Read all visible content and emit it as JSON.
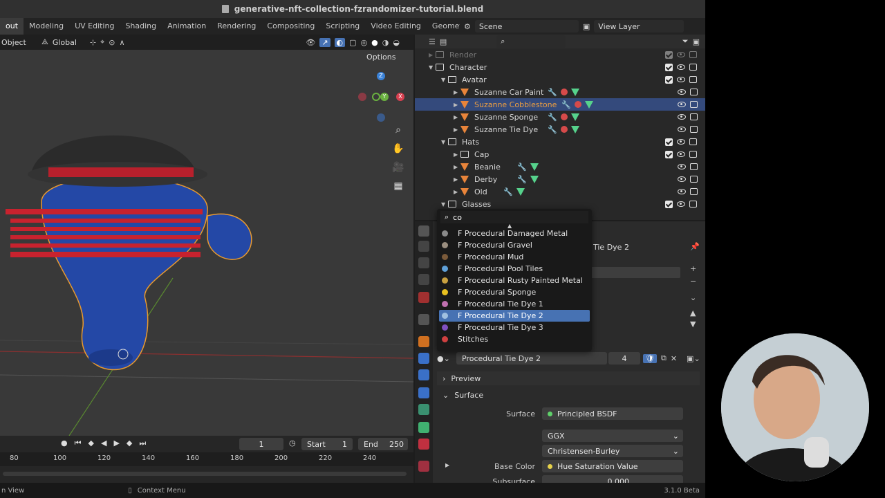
{
  "window": {
    "title": "generative-nft-collection-fzrandomizer-tutorial.blend"
  },
  "workspace_tabs": [
    "out",
    "Modeling",
    "UV Editing",
    "Shading",
    "Animation",
    "Rendering",
    "Compositing",
    "Scripting",
    "Video Editing",
    "Geometry Nodes",
    "+"
  ],
  "scene": {
    "scene_name": "Scene",
    "view_layer": "View Layer"
  },
  "viewport_header": {
    "mode": "Object",
    "transform_orientation": "Global"
  },
  "viewport": {
    "options_label": "Options"
  },
  "outliner": {
    "rows": [
      {
        "label": "Render",
        "dim": true
      },
      {
        "label": "Character"
      },
      {
        "label": "Avatar"
      },
      {
        "label": "Suzanne Car Paint"
      },
      {
        "label": "Suzanne Cobblestone",
        "selected": true
      },
      {
        "label": "Suzanne Sponge"
      },
      {
        "label": "Suzanne Tie Dye"
      },
      {
        "label": "Hats"
      },
      {
        "label": "Cap"
      },
      {
        "label": "Beanie"
      },
      {
        "label": "Derby"
      },
      {
        "label": "Old"
      },
      {
        "label": "Glasses"
      }
    ]
  },
  "material_dropdown": {
    "search_value": "co",
    "items": [
      {
        "label": "F Procedural Damaged Metal",
        "color": "#8a8a8a"
      },
      {
        "label": "F Procedural Gravel",
        "color": "#9b8f80"
      },
      {
        "label": "F Procedural Mud",
        "color": "#7a5a3a"
      },
      {
        "label": "F Procedural Pool Tiles",
        "color": "#5fa0d8"
      },
      {
        "label": "F Procedural Rusty Painted Metal",
        "color": "#c8a040"
      },
      {
        "label": "F Procedural Sponge",
        "color": "#e8c020"
      },
      {
        "label": "F Procedural Tie Dye 1",
        "color": "#c070b0"
      },
      {
        "label": "F Procedural Tie Dye 2",
        "color": "#a0c0e0",
        "highlighted": true
      },
      {
        "label": "F Procedural Tie Dye 3",
        "color": "#8050c0"
      },
      {
        "label": "Stitches",
        "color": "#d04040"
      }
    ]
  },
  "properties": {
    "material_slot_name": "Tie Dye 2",
    "material_name": "Procedural Tie Dye 2",
    "user_count": "4",
    "preview_label": "Preview",
    "surface_section": "Surface",
    "surface_label": "Surface",
    "surface_value": "Principled BSDF",
    "distribution": "GGX",
    "subsurface_method": "Christensen-Burley",
    "base_color_label": "Base Color",
    "base_color_value": "Hue Saturation Value",
    "subsurface_label": "Subsurface",
    "subsurface_value": "0.000"
  },
  "timeline": {
    "current_frame": "1",
    "start_label": "Start",
    "start_value": "1",
    "end_label": "End",
    "end_value": "250",
    "ruler": [
      "80",
      "100",
      "120",
      "140",
      "160",
      "180",
      "200",
      "220",
      "240"
    ]
  },
  "statusbar": {
    "left": "n View",
    "middle": "Context Menu",
    "version": "3.1.0 Beta"
  }
}
